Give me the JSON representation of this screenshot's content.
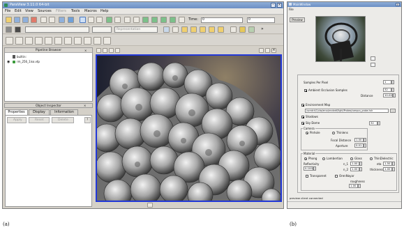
{
  "paraview": {
    "title": "ParaView 3.11.0 64-bit",
    "menu": [
      "File",
      "Edit",
      "View",
      "Sources",
      "Filters",
      "Tools",
      "Macros",
      "Help"
    ],
    "time_label": "Time:",
    "time_value": "0",
    "time_spin": "0",
    "representation_placeholder": "Representation",
    "pipeline": {
      "header": "Pipeline Browser",
      "root": "builtin:",
      "item": "rm_256_1iso.vtp"
    },
    "inspector": {
      "header": "Object Inspector",
      "tabs": [
        "Properties",
        "Display",
        "Information"
      ],
      "apply": "Apply",
      "reset": "Reset",
      "delete": "Delete",
      "help": "?"
    }
  },
  "renderer": {
    "title": "MainWindow",
    "menu_file": "File",
    "preview_label": "Preview",
    "samples_label": "Samples Per Pixel",
    "samples_value": "1",
    "ao_label": "Ambient Occlusion Samples",
    "ao_value": "32",
    "distance_label": "Distance",
    "distance_value": "10.00",
    "envmap_label": "Environment Map",
    "envmap_path": "/scratch/1/cbs/envs/envbrdf/light/Probes/campus_probe.hdr",
    "envmap_browse": "...",
    "shadows_label": "Shadows",
    "skydome_label": "Sky Dome",
    "skydome_value": "32",
    "camera": {
      "caption": "Camera",
      "pinhole": "Pinhole",
      "thinlens": "Thinlens",
      "focal_label": "Focal Distance",
      "focal_value": "1.00",
      "aperture_label": "Aperture",
      "aperture_value": "0.01"
    },
    "material": {
      "caption": "Material",
      "phong": "Phong",
      "lambertian": "Lambertian",
      "glass": "Glass",
      "thin_dielectric": "ThinDielectric",
      "reflectivity_label": "Reflectivity",
      "reflectivity_value": "0.100",
      "n1_label": "n_1",
      "n1_value": "1.00",
      "n2_label": "n_2",
      "n2_value": "1.00",
      "eta_label": "eta",
      "eta_value": "1.50",
      "thickness_label": "thickness",
      "thickness_value": "1.00",
      "transparent": "Transparent",
      "orennayar": "OrenNayar",
      "roughness_label": "roughness",
      "roughness_value": "1.00"
    },
    "status": "preview client connected"
  },
  "captions": {
    "a": "(a)",
    "b": "(b)"
  }
}
